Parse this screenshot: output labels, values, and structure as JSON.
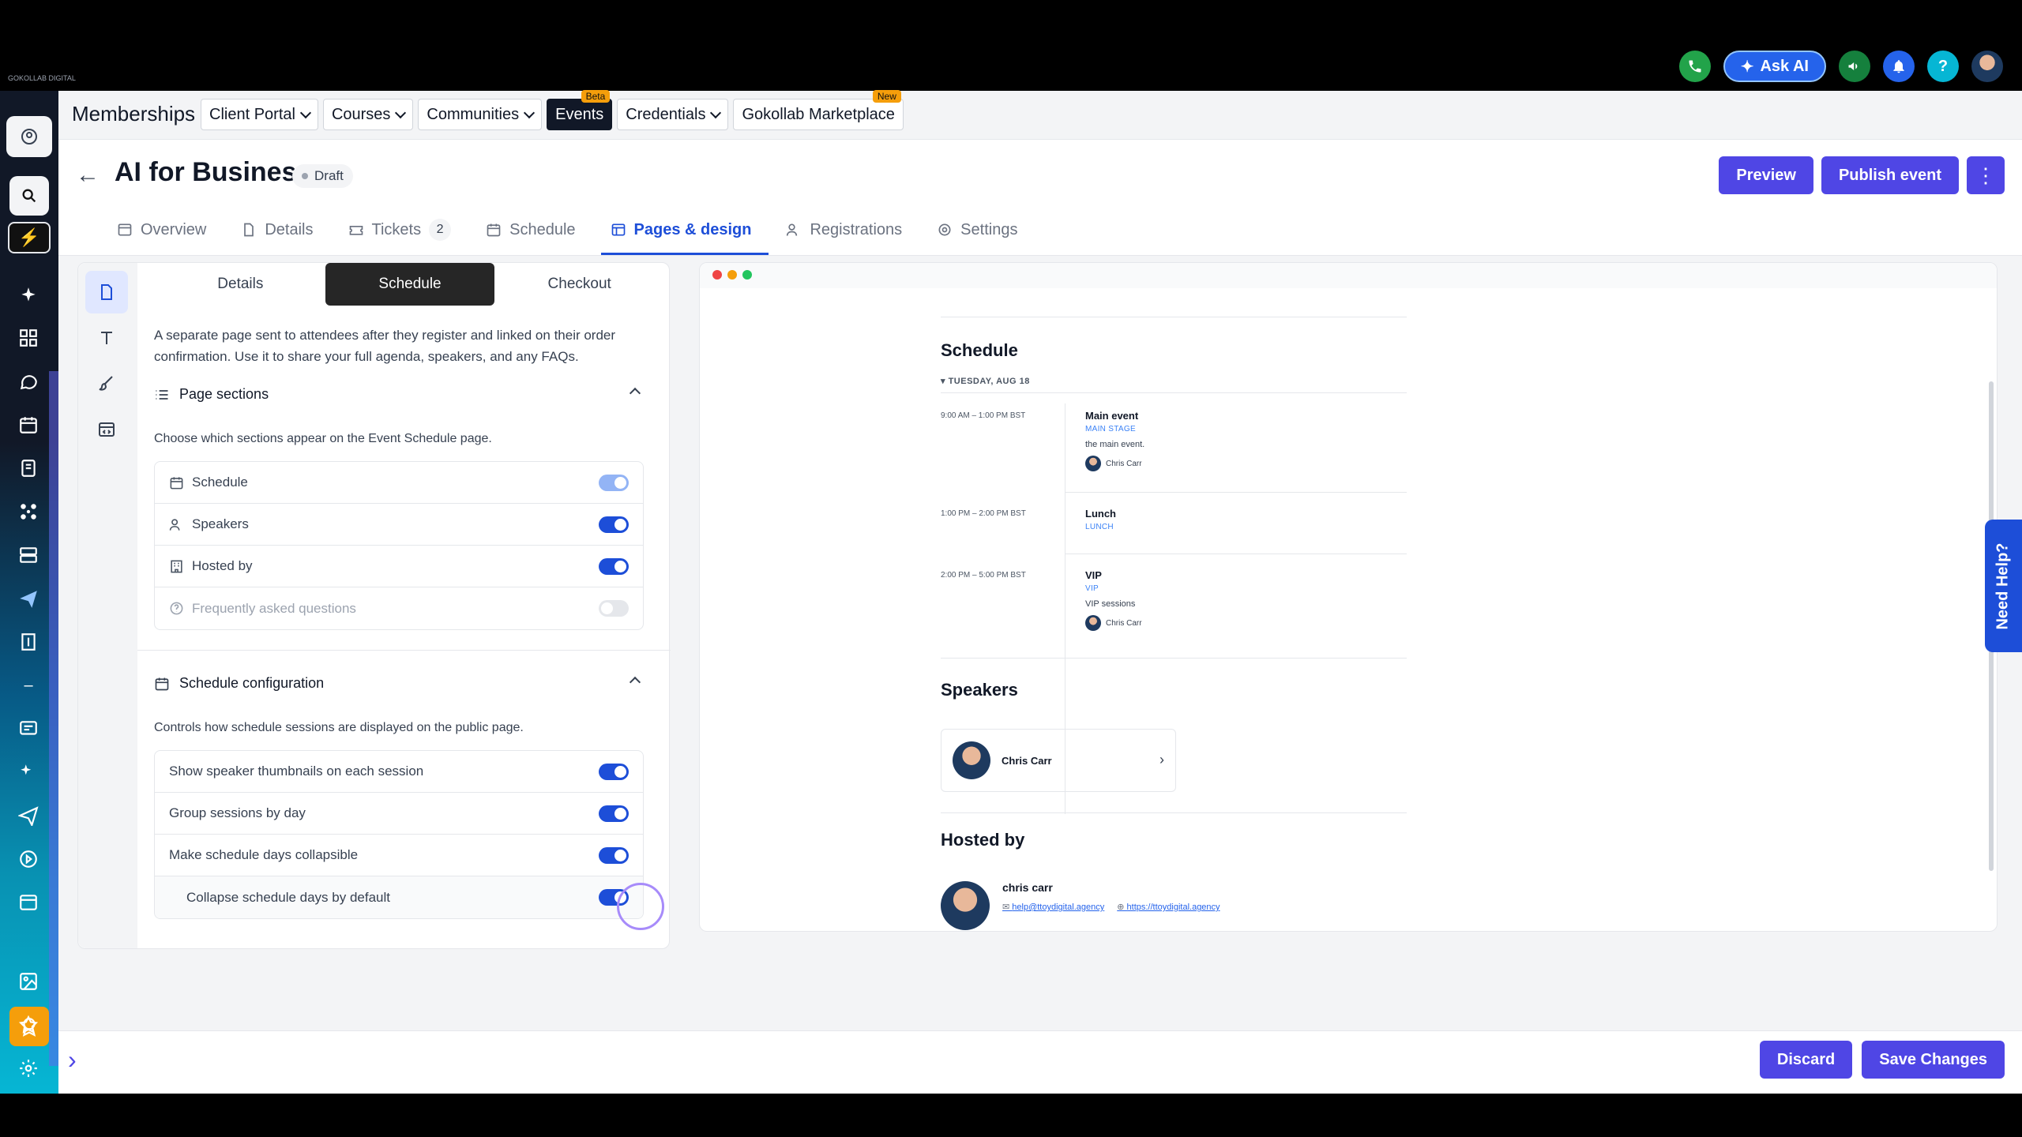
{
  "topbar": {
    "logo_text": "GOKOLLAB DIGITAL",
    "ask_ai_label": "Ask AI",
    "help_label": "?",
    "colors": {
      "phone": "#22a34a",
      "ask_ai": "#2563eb",
      "megaphone": "#15803d",
      "bell": "#2563eb",
      "help": "#06b6d4"
    },
    "icons": [
      "phone-icon",
      "sparkles-icon",
      "megaphone-icon",
      "bell-icon",
      "help-icon",
      "user-avatar"
    ]
  },
  "nav": {
    "title": "Memberships",
    "items": [
      {
        "label": "Client Portal",
        "dropdown": true
      },
      {
        "label": "Courses",
        "dropdown": true
      },
      {
        "label": "Communities",
        "dropdown": true
      },
      {
        "label": "Events",
        "badge": "Beta",
        "active": true
      },
      {
        "label": "Credentials",
        "dropdown": true
      },
      {
        "label": "Gokollab Marketplace",
        "badge": "New"
      }
    ]
  },
  "header": {
    "title": "AI for Business",
    "status": "Draft",
    "preview_label": "Preview",
    "publish_label": "Publish event",
    "more_label": "⋮"
  },
  "tabs": [
    {
      "label": "Overview",
      "icon": "layout-icon"
    },
    {
      "label": "Details",
      "icon": "document-icon"
    },
    {
      "label": "Tickets",
      "icon": "ticket-icon",
      "count": "2"
    },
    {
      "label": "Schedule",
      "icon": "calendar-icon"
    },
    {
      "label": "Pages & design",
      "icon": "pages-icon",
      "active": true
    },
    {
      "label": "Registrations",
      "icon": "users-icon"
    },
    {
      "label": "Settings",
      "icon": "gear-icon"
    }
  ],
  "panel": {
    "segments": [
      "Details",
      "Schedule",
      "Checkout"
    ],
    "active_segment": "Schedule",
    "description": "A separate page sent to attendees after they register and linked on their order confirmation. Use it to share your full agenda, speakers, and any FAQs.",
    "page_sections": {
      "title": "Page sections",
      "subtitle": "Choose which sections appear on the Event Schedule page.",
      "rows": [
        {
          "label": "Schedule",
          "state": "on-locked"
        },
        {
          "label": "Speakers",
          "state": "on"
        },
        {
          "label": "Hosted by",
          "state": "on"
        },
        {
          "label": "Frequently asked questions",
          "state": "off"
        }
      ]
    },
    "schedule_config": {
      "title": "Schedule configuration",
      "subtitle": "Controls how schedule sessions are displayed on the public page.",
      "rows": [
        {
          "label": "Show speaker thumbnails on each session",
          "state": "on"
        },
        {
          "label": "Group sessions by day",
          "state": "on"
        },
        {
          "label": "Make schedule days collapsible",
          "state": "on"
        },
        {
          "label": "Collapse schedule days by default",
          "state": "on",
          "focused": true
        }
      ]
    }
  },
  "preview": {
    "schedule_heading": "Schedule",
    "day_label": "▾ TUESDAY, AUG 18",
    "sessions": [
      {
        "time": "9:00 AM – 1:00 PM BST",
        "title": "Main event",
        "location": "MAIN STAGE",
        "description": "the main event.",
        "speaker": "Chris Carr"
      },
      {
        "time": "1:00 PM – 2:00 PM BST",
        "title": "Lunch",
        "location": "LUNCH"
      },
      {
        "time": "2:00 PM – 5:00 PM BST",
        "title": "VIP",
        "location": "VIP",
        "description": "VIP sessions",
        "speaker": "Chris Carr"
      }
    ],
    "speakers_heading": "Speakers",
    "speaker_card": {
      "name": "Chris Carr",
      "arrow": "›"
    },
    "hosted_heading": "Hosted by",
    "host": {
      "name": "chris carr",
      "email": "help@ttoydigital.agency",
      "website": "https://ttoydigital.agency"
    }
  },
  "need_help_label": "Need Help?",
  "footer": {
    "discard_label": "Discard",
    "save_label": "Save Changes",
    "expand_icon": "›"
  }
}
